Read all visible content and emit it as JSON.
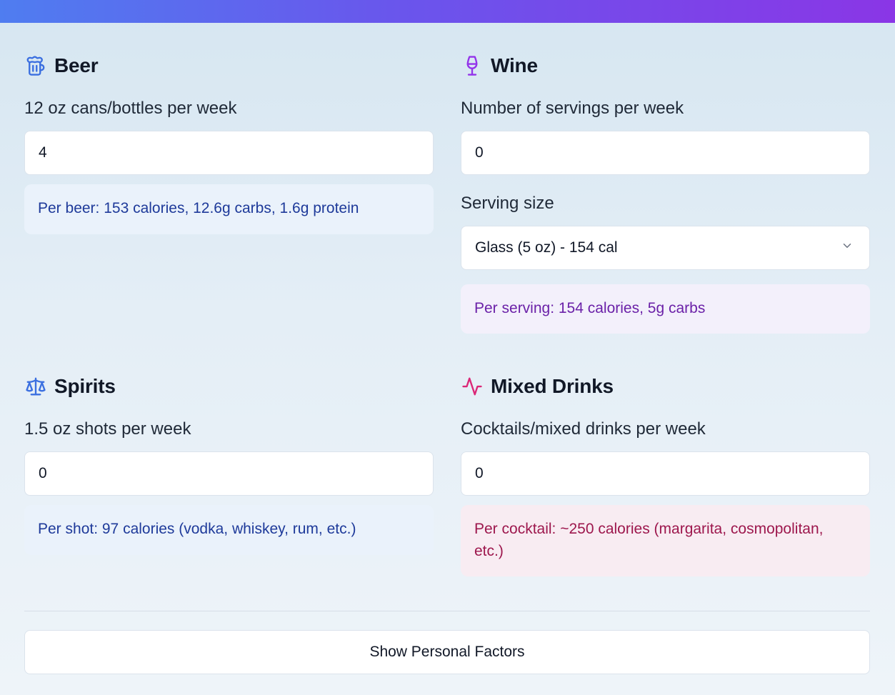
{
  "colors": {
    "beer_icon": "#3b6fe0",
    "wine_icon": "#9333ea",
    "spirits_icon": "#3b6fe0",
    "mixed_icon": "#db2777"
  },
  "beer": {
    "title": "Beer",
    "icon": "beer-mug-icon",
    "field_label": "12 oz cans/bottles per week",
    "value": "4",
    "info": "Per beer: 153 calories, 12.6g carbs, 1.6g protein"
  },
  "wine": {
    "title": "Wine",
    "icon": "wine-glass-icon",
    "field_label": "Number of servings per week",
    "value": "0",
    "serving_label": "Serving size",
    "serving_selected": "Glass (5 oz) - 154 cal",
    "info": "Per serving: 154 calories, 5g carbs"
  },
  "spirits": {
    "title": "Spirits",
    "icon": "scale-icon",
    "field_label": "1.5 oz shots per week",
    "value": "0",
    "info": "Per shot: 97 calories (vodka, whiskey, rum, etc.)"
  },
  "mixed": {
    "title": "Mixed Drinks",
    "icon": "activity-icon",
    "field_label": "Cocktails/mixed drinks per week",
    "value": "0",
    "info": "Per cocktail: ~250 calories (margarita, cosmopolitan, etc.)"
  },
  "footer": {
    "button_label": "Show Personal Factors"
  }
}
